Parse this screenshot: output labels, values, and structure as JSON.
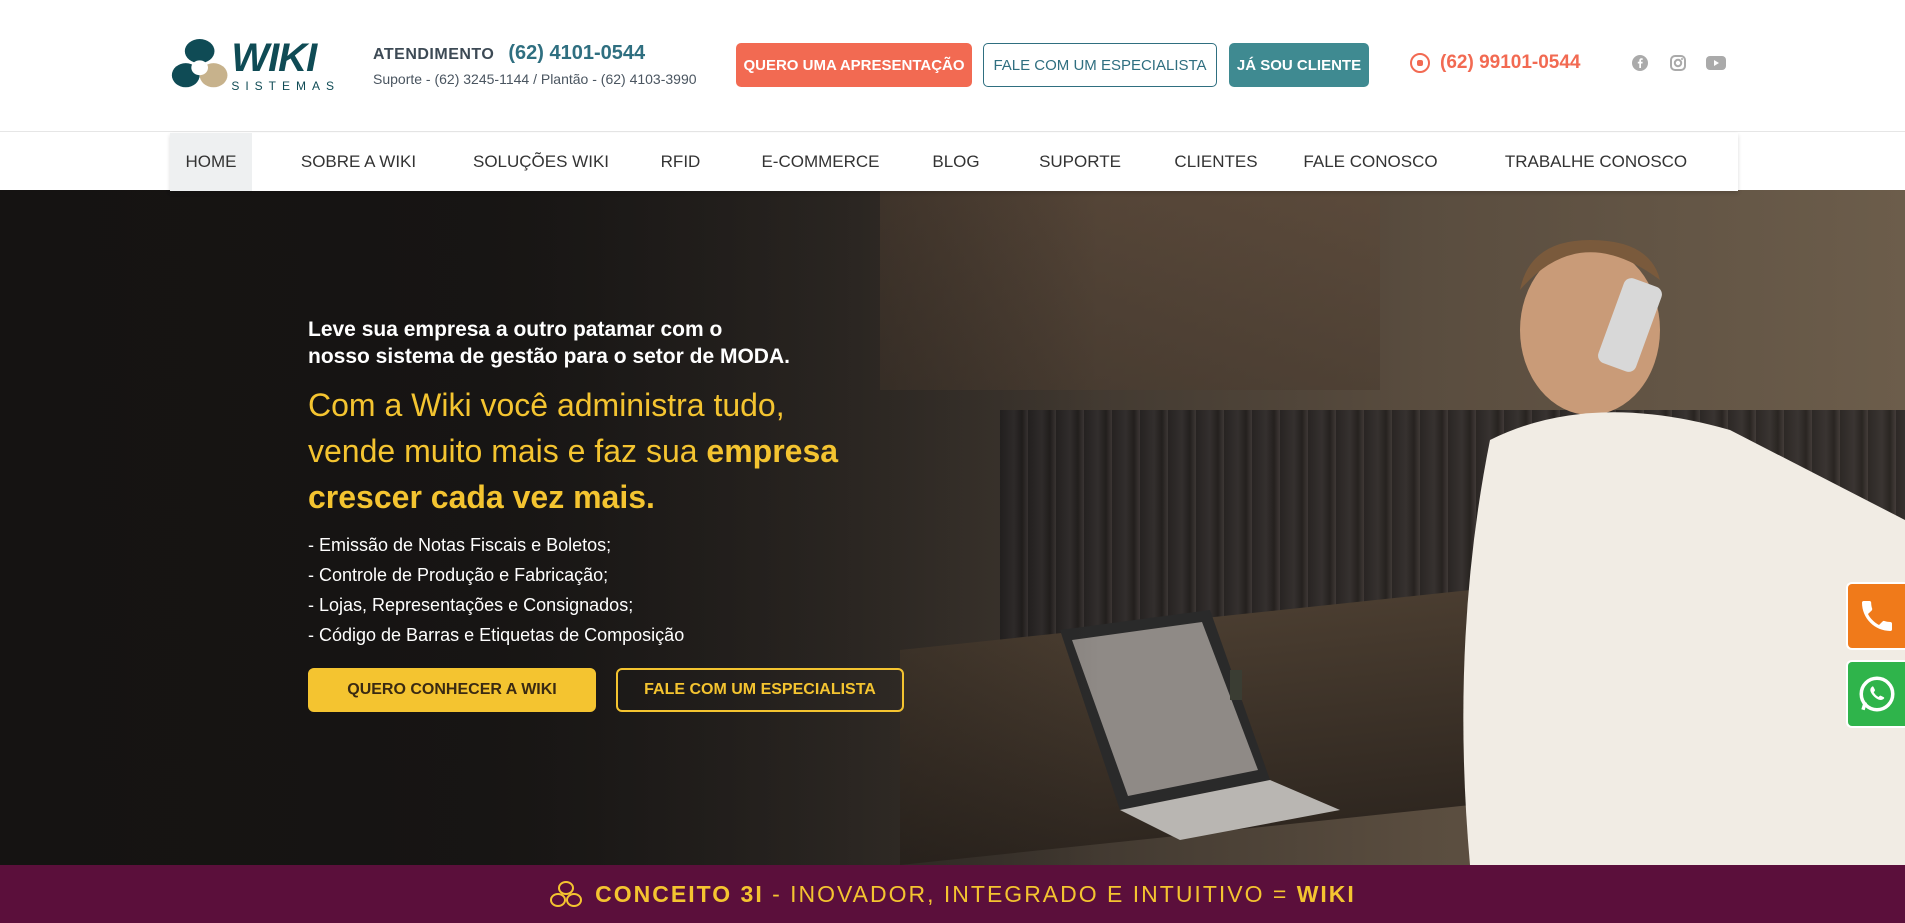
{
  "header": {
    "logo": {
      "word": "WIKI",
      "sub": "SISTEMAS"
    },
    "contact": {
      "label": "ATENDIMENTO",
      "phone": "(62) 4101-0544",
      "support_prefix": "Suporte - ",
      "support_phone": "(62) 3245-1144",
      "plantao_prefix": " / Plantão - ",
      "plantao_phone": "(62) 4103-3990"
    },
    "buttons": {
      "apresentacao": "QUERO UMA APRESENTAÇÃO",
      "especialista": "FALE COM UM ESPECIALISTA",
      "cliente": "JÁ SOU CLIENTE"
    },
    "whatsapp": "(62) 99101-0544",
    "social": [
      "facebook-icon",
      "instagram-icon",
      "youtube-icon"
    ]
  },
  "nav": {
    "items": [
      {
        "label": "HOME",
        "active": true
      },
      {
        "label": "SOBRE A WIKI"
      },
      {
        "label": "SOLUÇÕES WIKI"
      },
      {
        "label": "RFID"
      },
      {
        "label": "E-COMMERCE"
      },
      {
        "label": "BLOG"
      },
      {
        "label": "SUPORTE"
      },
      {
        "label": "CLIENTES"
      },
      {
        "label": "FALE CONOSCO"
      },
      {
        "label": "TRABALHE CONOSCO"
      }
    ]
  },
  "hero": {
    "intro_line1": "Leve sua empresa a outro patamar com o",
    "intro_line2": "nosso sistema de gestão para o setor de MODA.",
    "headline_line1": "Com a Wiki você administra tudo,",
    "headline_line2_plain": "vende muito mais e faz sua ",
    "headline_line2_bold": "empresa",
    "headline_line3_bold": "crescer cada vez mais.",
    "features": [
      "- Emissão de Notas Fiscais e Boletos;",
      "- Controle de Produção e Fabricação;",
      "- Lojas, Representações e Consignados;",
      "- Código de Barras e Etiquetas de Composição"
    ],
    "cta_primary": "QUERO CONHECER A WIKI",
    "cta_secondary": "FALE COM UM ESPECIALISTA"
  },
  "conceito": {
    "bold1": "CONCEITO 3I",
    "middle": " - INOVADOR, INTEGRADO E INTUITIVO = ",
    "bold2": "WIKI"
  },
  "colors": {
    "teal": "#2f6f80",
    "coral": "#f26a52",
    "yellow": "#f4c430",
    "wine": "#5b0f3b"
  }
}
